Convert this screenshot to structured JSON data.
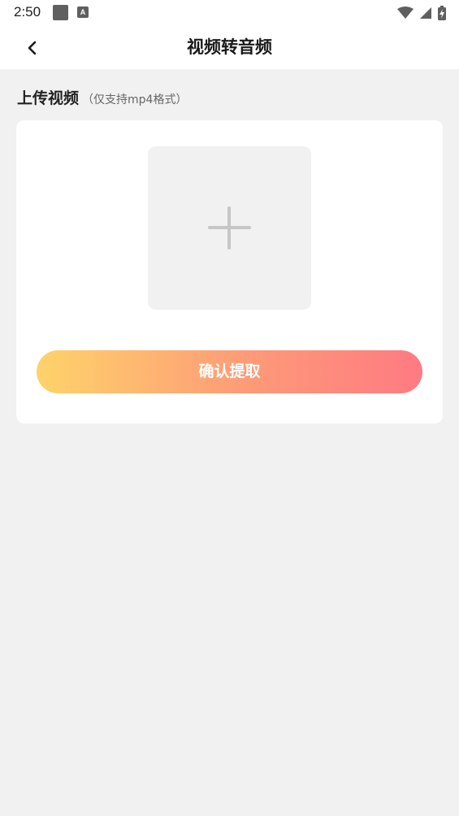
{
  "status_bar": {
    "time": "2:50",
    "notification_icon": "square-icon",
    "a_badge": "A",
    "wifi_icon": "wifi-icon",
    "signal_icon": "signal-icon",
    "battery_icon": "battery-charging-icon"
  },
  "header": {
    "title": "视频转音频",
    "back_icon": "chevron-left-icon"
  },
  "upload_section": {
    "title": "上传视频",
    "hint": "（仅支持mp4格式）",
    "add_icon": "plus-icon"
  },
  "actions": {
    "confirm_label": "确认提取"
  },
  "colors": {
    "background": "#f1f1f1",
    "gradient_start": "#fed36a",
    "gradient_end": "#ff7a83"
  }
}
